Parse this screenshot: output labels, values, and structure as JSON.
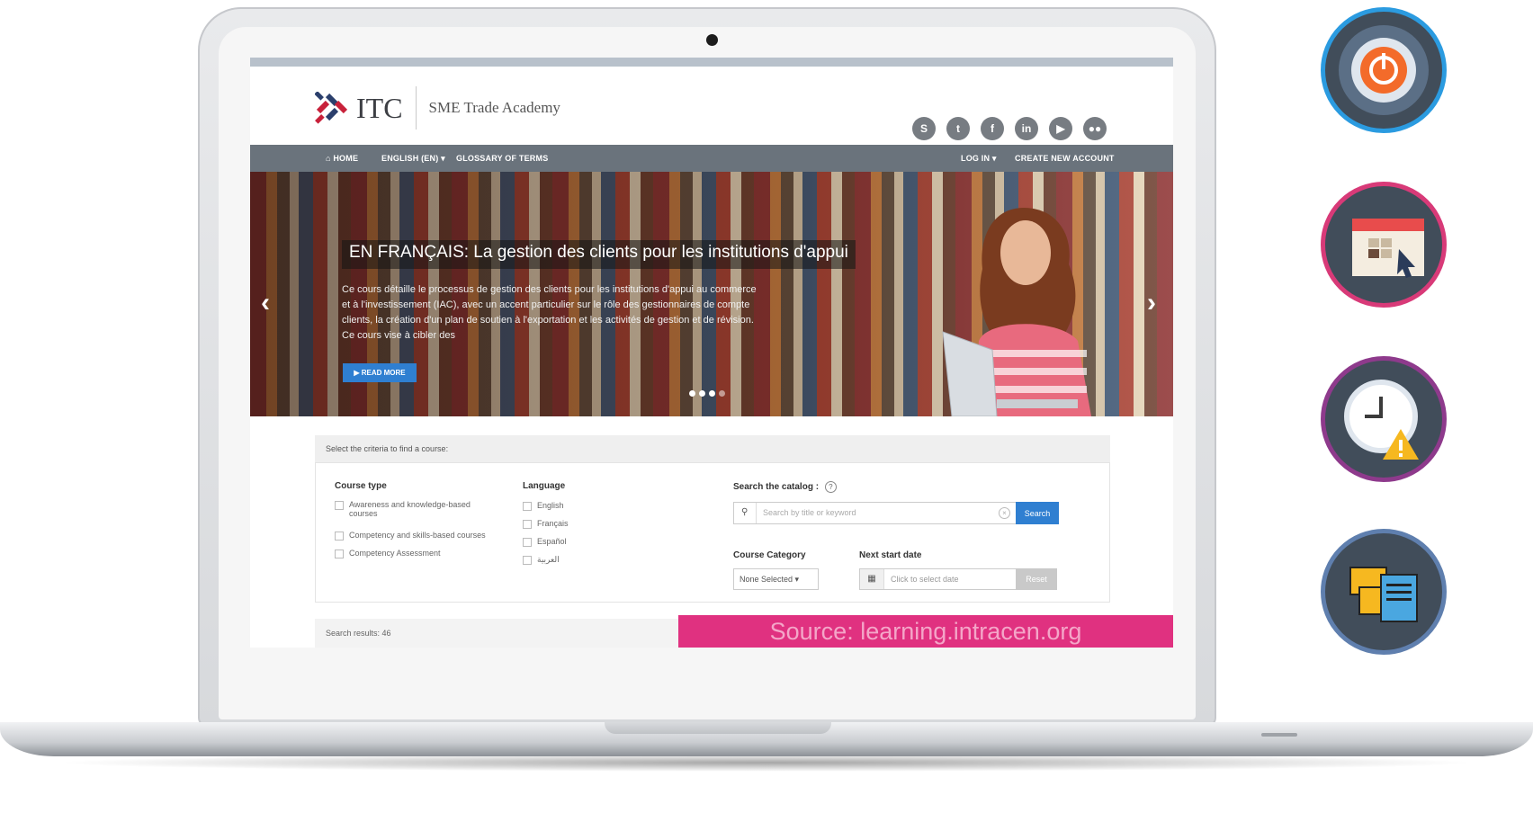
{
  "site": {
    "logo_text": "ITC",
    "subtitle": "SME Trade Academy",
    "social_icons": [
      "skype-icon",
      "twitter-icon",
      "facebook-icon",
      "linkedin-icon",
      "youtube-icon",
      "flickr-icon"
    ],
    "social_glyphs": [
      "S",
      "t",
      "f",
      "in",
      "▶",
      "●●"
    ]
  },
  "nav": {
    "home": "HOME",
    "language": "ENGLISH (EN) ▾",
    "glossary": "GLOSSARY OF TERMS",
    "login": "LOG IN ▾",
    "create_account": "CREATE NEW ACCOUNT"
  },
  "hero": {
    "title": "EN FRANÇAIS: La gestion des clients pour les institutions d'appui",
    "description": "Ce cours détaille le processus de gestion des clients pour les institutions d'appui au commerce et à l'investissement (IAC), avec un accent particulier sur le rôle des gestionnaires de compte clients, la création d'un plan de soutien à l'exportation et les activités de gestion et de révision. Ce cours vise à cibler des",
    "read_more": "▶ READ MORE",
    "prev_arrow": "‹",
    "next_arrow": "›",
    "active_slide": 4,
    "slide_count": 4
  },
  "filters": {
    "header": "Select the criteria to find a course:",
    "course_type_label": "Course type",
    "course_types": [
      "Awareness and knowledge-based courses",
      "Competency and skills-based courses",
      "Competency Assessment"
    ],
    "language_label": "Language",
    "languages": [
      "English",
      "Français",
      "Español",
      "العربية"
    ],
    "search_label": "Search the catalog :",
    "search_placeholder": "Search by title or keyword",
    "search_button": "Search",
    "category_label": "Course Category",
    "category_value": "None Selected ▾",
    "date_label": "Next start date",
    "date_placeholder": "Click to select date",
    "reset_button": "Reset"
  },
  "results": {
    "text": "Search results: 46"
  },
  "source_caption": "Source: learning.intracen.org",
  "side_icons": [
    "power-icon",
    "calendar-icon",
    "clock-warning-icon",
    "documents-icon"
  ],
  "colors": {
    "navbar": "#6a737c",
    "accent_blue": "#2f7fd1",
    "source_banner": "#e03180",
    "icon_ring_1": "#2b9be0",
    "icon_ring_2": "#d83a78",
    "icon_ring_3": "#8e3a8c",
    "icon_ring_4": "#5f7fae"
  }
}
